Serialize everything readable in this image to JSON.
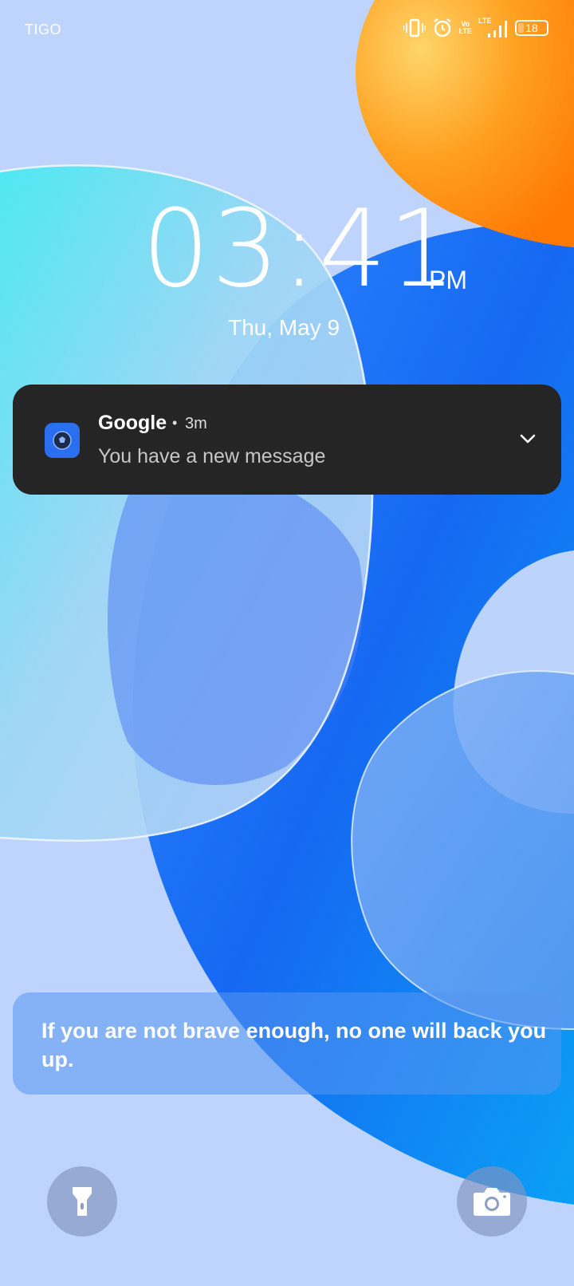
{
  "status_bar": {
    "carrier": "TIGO",
    "icons": [
      "vibrate-icon",
      "alarm-icon",
      "volte-icon",
      "lte-signal-icon",
      "battery-icon"
    ],
    "volte_top": "Vo",
    "volte_bottom": "LTE",
    "lte_label": "LTE",
    "battery_level": "18"
  },
  "clock": {
    "time": "03:41",
    "ampm": "PM",
    "date": "Thu, May 9"
  },
  "notification": {
    "app_name": "Google",
    "separator": "•",
    "time_ago": "3m",
    "message": "You have a new message",
    "icon": "google-app-icon",
    "expand_icon": "chevron-down-icon"
  },
  "quote": {
    "text": "If you are not brave enough, no one will back you up."
  },
  "shortcuts": {
    "left_icon": "flashlight-icon",
    "right_icon": "camera-icon"
  },
  "colors": {
    "background": "#bcd3fb",
    "notification_bg": "#252525",
    "app_icon": "#2a6ff0",
    "orange_blob": "#ff8a10",
    "blue_blob": "#1a6cf5"
  }
}
